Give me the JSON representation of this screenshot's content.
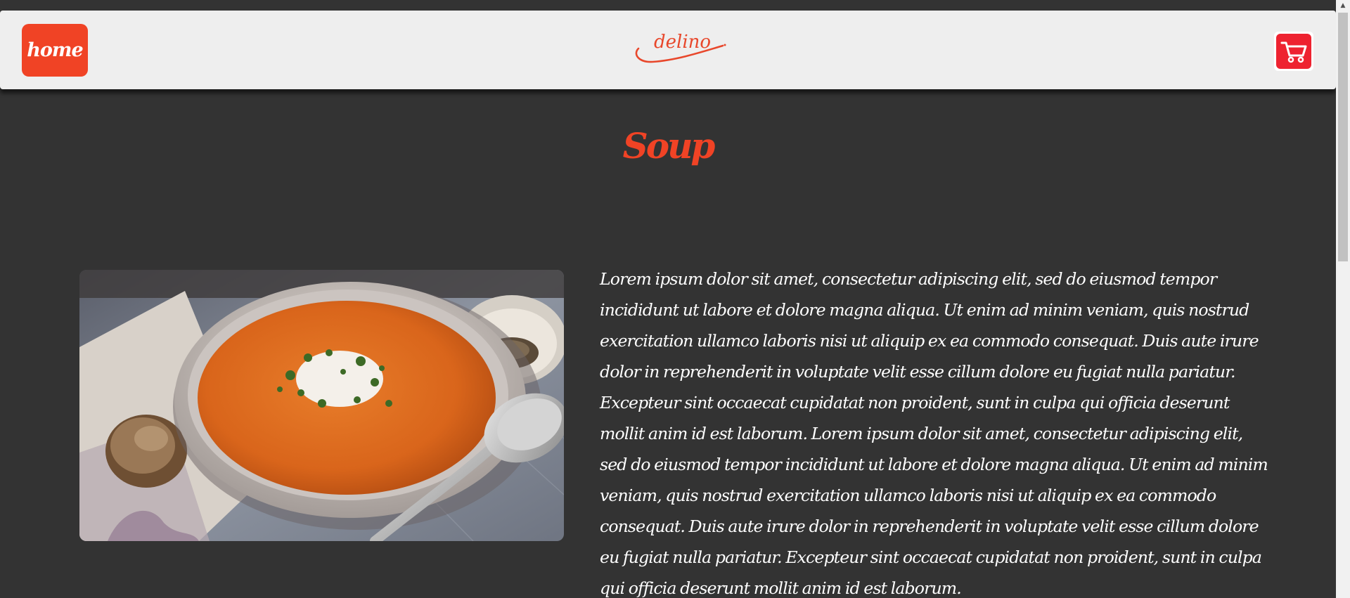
{
  "nav": {
    "home_label": "home",
    "logo_text": "delino",
    "cart_icon": "shopping-cart-icon"
  },
  "page": {
    "title": "Soup",
    "image_subject": "bowl-of-tomato-soup-photo",
    "description": "Lorem ipsum dolor sit amet, consectetur adipiscing elit, sed do eiusmod tempor incididunt ut labore et dolore magna aliqua. Ut enim ad minim veniam, quis nostrud exercitation ullamco laboris nisi ut aliquip ex ea commodo consequat. Duis aute irure dolor in reprehenderit in voluptate velit esse cillum dolore eu fugiat nulla pariatur. Excepteur sint occaecat cupidatat non proident, sunt in culpa qui officia deserunt mollit anim id est laborum. Lorem ipsum dolor sit amet, consectetur adipiscing elit, sed do eiusmod tempor incididunt ut labore et dolore magna aliqua. Ut enim ad minim veniam, quis nostrud exercitation ullamco laboris nisi ut aliquip ex ea commodo consequat. Duis aute irure dolor in reprehenderit in voluptate velit esse cillum dolore eu fugiat nulla pariatur. Excepteur sint occaecat cupidatat non proident, sunt in culpa qui officia deserunt mollit anim id est laborum."
  },
  "colors": {
    "background": "#333333",
    "navbar": "#eeeeee",
    "accent": "#f04325",
    "cart": "#ee2230",
    "text": "#ffffff"
  }
}
